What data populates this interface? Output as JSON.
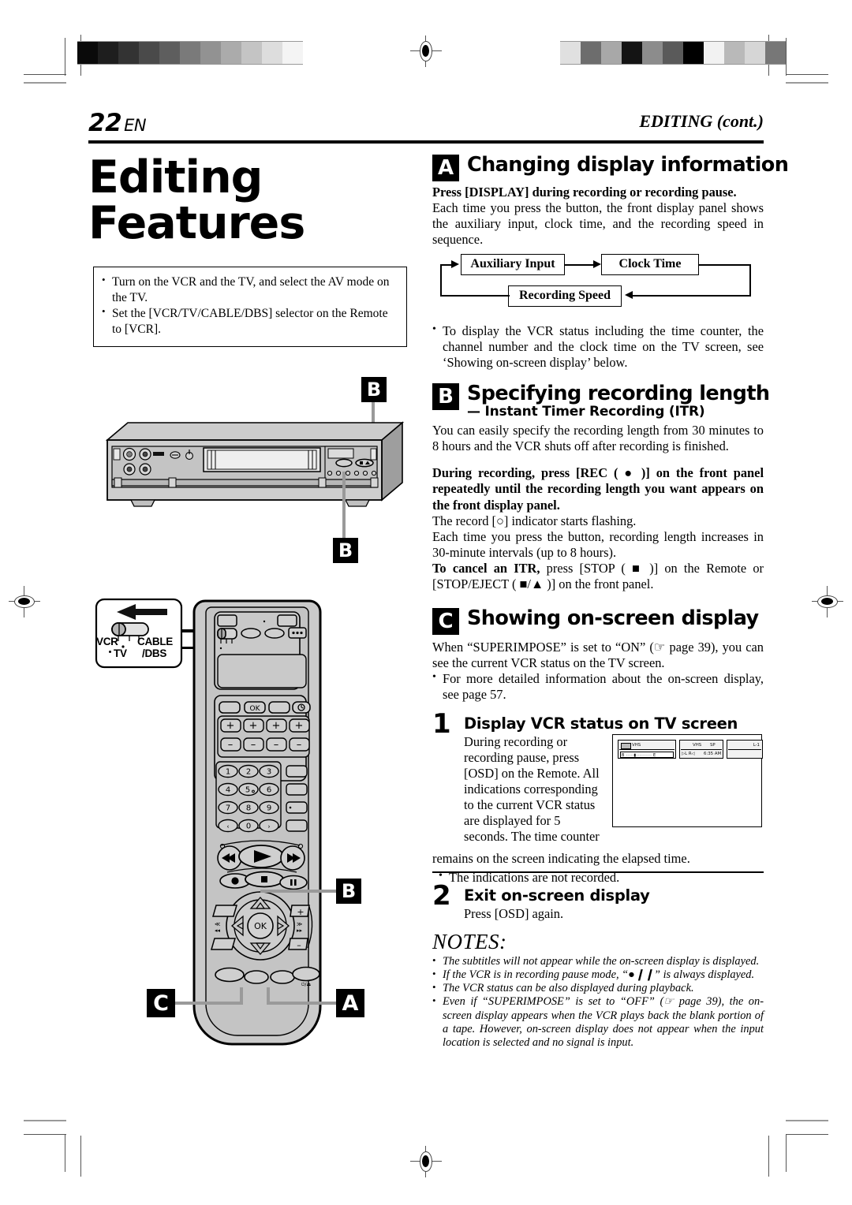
{
  "header": {
    "page_number": "22",
    "language_code": "EN",
    "section_name": "EDITING (cont.)"
  },
  "left": {
    "title_line1": "Editing",
    "title_line2": "Features",
    "prep_bullets": [
      "Turn on the VCR and the TV, and select the AV mode on the TV.",
      "Set the [VCR/TV/CABLE/DBS] selector on the Remote to [VCR]."
    ],
    "callouts": {
      "vcr_top": "B",
      "vcr_bottom": "B",
      "remote_stop": "B",
      "remote_left": "C",
      "remote_right": "A"
    },
    "remote_selector": {
      "label_vcr": "VCR",
      "label_tv": "TV",
      "label_cable": "CABLE",
      "label_dbs": "/DBS"
    },
    "remote_keys": {
      "ok": "OK",
      "numbers": [
        "1",
        "2",
        "3",
        "4",
        "5",
        "6",
        "7",
        "8",
        "9",
        "0"
      ],
      "plus": "+",
      "minus": "−",
      "left_arrow": "‹",
      "right_arrow": "›"
    }
  },
  "sections": {
    "a": {
      "badge": "A",
      "title": "Changing display information",
      "lead": "Press [DISPLAY] during recording or recording pause.",
      "body": "Each time you press the button, the front display panel shows the auxiliary input, clock time, and the recording speed in sequence.",
      "flow": {
        "box1": "Auxiliary Input",
        "box2": "Clock Time",
        "box3": "Recording Speed"
      },
      "bullets": [
        "To display the VCR status including the time counter, the channel number and the clock time on the TV screen, see ‘Showing on-screen display’ below."
      ]
    },
    "b": {
      "badge": "B",
      "title": "Specifying recording length",
      "subtitle": "— Instant Timer Recording (ITR)",
      "body1": "You can easily specify the recording length from 30 minutes to 8 hours and the VCR shuts off after recording is finished.",
      "bold_block": "During recording, press [REC ( ● )] on the front panel repeatedly until the recording length you want appears on the front display panel.",
      "body2": "The record [○] indicator starts flashing.",
      "body3": "Each time you press the button, recording length increases in 30-minute intervals (up to 8 hours).",
      "cancel_bold": "To cancel an ITR,",
      "cancel_rest": " press [STOP ( ■ )] on the Remote or [STOP/EJECT ( ■/▲ )] on the front panel."
    },
    "c": {
      "badge": "C",
      "title": "Showing on-screen display",
      "body1": "When “SUPERIMPOSE” is set to “ON” (☞ page 39), you can see the current VCR status on the TV screen.",
      "bullets": [
        "For more detailed information about the on-screen display, see page 57."
      ],
      "step1": {
        "number": "1",
        "title": "Display VCR status on TV screen",
        "body_left": "During recording or recording pause, press [OSD] on the Remote. All indications corresponding to the current VCR status are displayed for 5 seconds. The time counter",
        "body_full": "remains on the screen indicating the elapsed time.",
        "bullet": "The indications are not recorded."
      },
      "step2": {
        "number": "2",
        "title": "Exit on-screen display",
        "body": "Press [OSD] again."
      },
      "osd_screen": {
        "tape_format": "VHS",
        "bar_start": "B",
        "bar_end": "E",
        "speed_format": "VHS",
        "speed": "SP",
        "audio": "▷L R◁",
        "clock": "6:35 AM",
        "channel": "L-1"
      }
    }
  },
  "notes": {
    "title": "NOTES:",
    "items": [
      "The subtitles will not appear while the on-screen display is displayed.",
      "If the VCR is in recording pause mode, “●❙❙” is always displayed.",
      "The VCR status can be also displayed during playback.",
      "Even if “SUPERIMPOSE” is set to “OFF” (☞ page 39), the on-screen display appears when the VCR plays back the blank portion of a tape. However, on-screen display does not appear when the input location is selected and no signal is input."
    ]
  },
  "colors": {
    "ink": "#000000",
    "paper": "#ffffff",
    "leader": "#9a9a9a",
    "device_body": "#c9c9c9",
    "device_shadow": "#8e8e8e"
  }
}
